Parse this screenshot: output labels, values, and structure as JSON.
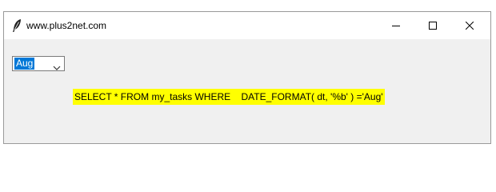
{
  "window": {
    "title": "www.plus2net.com",
    "app_icon": "feather-icon",
    "controls": {
      "minimize_icon": "minimize-icon",
      "maximize_icon": "maximize-icon",
      "close_icon": "close-icon"
    }
  },
  "month_select": {
    "value": "Aug",
    "arrow_icon": "chevron-down-icon"
  },
  "query_label": {
    "text": "SELECT * FROM my_tasks WHERE    DATE_FORMAT( dt, '%b' ) ='Aug'",
    "background_color": "#ffff00"
  },
  "colors": {
    "selection": "#0078d7",
    "client_background": "#f0f0f0"
  }
}
